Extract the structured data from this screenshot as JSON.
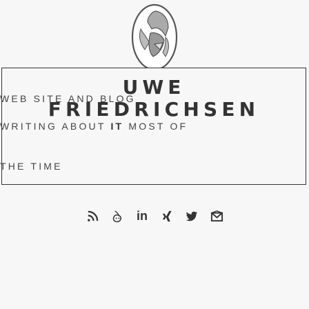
{
  "header": {
    "title_line1": "UWE",
    "title_line2": "FRIEDRICHSEN",
    "tagline_line1": "WEB SITE AND BLOG",
    "tagline_line2_pre": "WRITING ABOUT ",
    "tagline_line2_emph": "IT",
    "tagline_line2_post": " MOST OF",
    "tagline_line3": "THE TIME"
  },
  "social": [
    {
      "name": "rss",
      "icon": "rss-icon"
    },
    {
      "name": "keybase",
      "icon": "keybase-icon"
    },
    {
      "name": "linkedin",
      "icon": "linkedin-icon",
      "glyph": "in"
    },
    {
      "name": "xing",
      "icon": "xing-icon"
    },
    {
      "name": "twitter",
      "icon": "twitter-icon"
    },
    {
      "name": "email",
      "icon": "email-icon"
    }
  ]
}
